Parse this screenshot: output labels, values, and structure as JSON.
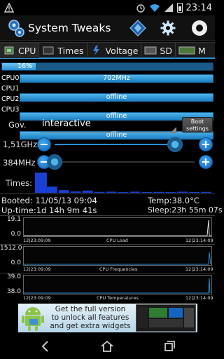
{
  "status_bar": {
    "time": "23:14"
  },
  "app": {
    "title": "System Tweaks"
  },
  "tabs": [
    {
      "label": "CPU",
      "active": true
    },
    {
      "label": "Times",
      "active": false
    },
    {
      "label": "Voltage",
      "active": false
    },
    {
      "label": "SD",
      "active": false
    },
    {
      "label": "M",
      "active": false
    }
  ],
  "cpu": {
    "load_percent_label": "16%",
    "load_fraction": 0.16,
    "cores": [
      {
        "label": "CPU0",
        "value": "702MHz"
      },
      {
        "label": "CPU1",
        "value": "offline"
      },
      {
        "label": "CPU2",
        "value": "offline"
      },
      {
        "label": "CPU3",
        "value": "offline"
      }
    ]
  },
  "governor": {
    "label": "Gov.",
    "value": "interactive",
    "boot_button": "Boot settings"
  },
  "frequency": {
    "max_label": "1,51GHz",
    "max_fraction": 0.86,
    "min_label": "384MHz",
    "min_fraction": 0.0,
    "minus": "−",
    "plus": "+"
  },
  "times": {
    "label": "Times:",
    "bars": [
      0.9,
      0.28,
      0.12,
      0.06,
      0.1,
      0.04,
      0.05,
      0.03,
      0.05,
      0.03,
      0.04,
      0.03,
      0.05,
      0.03,
      0.04
    ]
  },
  "info": {
    "booted": "Booted:  11/05/13 09:04",
    "temp": "Temp:38.0°C",
    "uptime": "Up-time:1d 14h 9m 41s",
    "sleep": "Sleep:23h 55m 07s"
  },
  "graphs": [
    {
      "title": "CPU Load",
      "y_max": "19.1",
      "y_min": "0.0",
      "t_start": "12|23:09:09",
      "t_end": "12|23:14:09"
    },
    {
      "title": "CPU Frequencies",
      "y_max": "1512.0",
      "y_min": "0.0",
      "t_start": "12|23:09:09",
      "t_end": "12|23:14:09"
    },
    {
      "title": "CPU Temperatures",
      "y_max": "39.0",
      "y_min": "38.0",
      "t_start": "12|23:09:09",
      "t_end": "12|23:14:09"
    }
  ],
  "ad": {
    "line1": "Get the full version",
    "line2": "to unlock all features",
    "line3": "and get extra widgets"
  },
  "colors": {
    "accent": "#2a8fd6",
    "bar": "#3a9ee0"
  }
}
